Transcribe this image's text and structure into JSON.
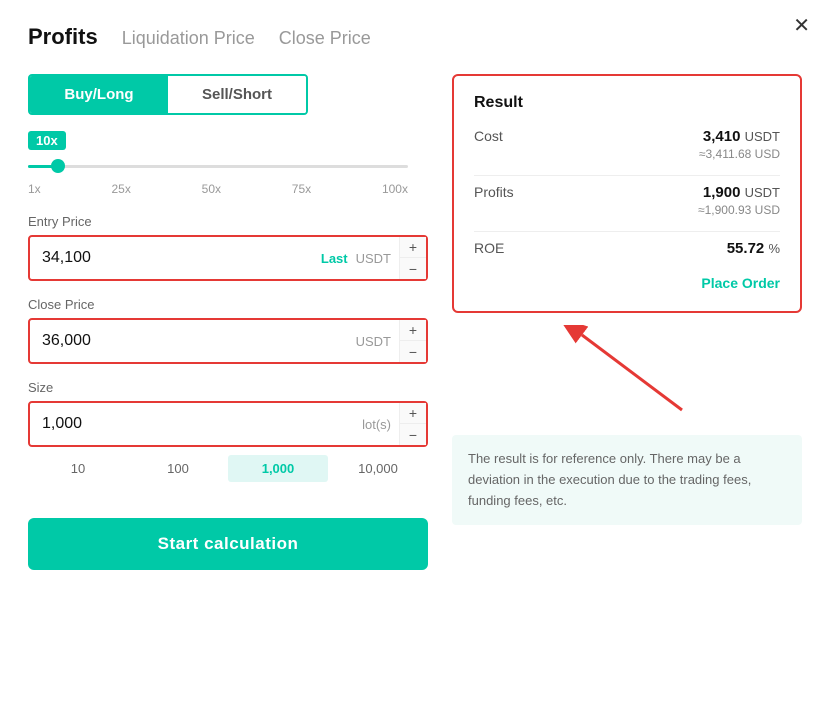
{
  "modal": {
    "close_label": "✕"
  },
  "tabs": [
    {
      "label": "Profits",
      "active": true
    },
    {
      "label": "Liquidation Price",
      "active": false
    },
    {
      "label": "Close Price",
      "active": false
    }
  ],
  "toggle": {
    "buy_label": "Buy/Long",
    "sell_label": "Sell/Short"
  },
  "leverage": {
    "badge": "10x",
    "marks": [
      "1x",
      "25x",
      "50x",
      "75x",
      "100x"
    ]
  },
  "entry_price": {
    "label": "Entry Price",
    "value": "34,100",
    "suffix": "Last",
    "unit": "USDT",
    "plus": "+",
    "minus": "−"
  },
  "close_price": {
    "label": "Close Price",
    "value": "36,000",
    "unit": "USDT",
    "plus": "+",
    "minus": "−"
  },
  "size": {
    "label": "Size",
    "value": "1,000",
    "unit": "lot(s)",
    "plus": "+",
    "minus": "−",
    "options": [
      "10",
      "100",
      "1,000",
      "10,000"
    ]
  },
  "start_button": "Start calculation",
  "result": {
    "title": "Result",
    "cost_label": "Cost",
    "cost_value": "3,410",
    "cost_unit": "USDT",
    "cost_sub": "≈3,411.68 USD",
    "profits_label": "Profits",
    "profits_value": "1,900",
    "profits_unit": "USDT",
    "profits_sub": "≈1,900.93 USD",
    "roe_label": "ROE",
    "roe_value": "55.72",
    "roe_unit": "%"
  },
  "place_order_label": "Place Order",
  "disclaimer": "The result is for reference only. There may be a deviation in the execution due to the trading fees, funding fees, etc."
}
